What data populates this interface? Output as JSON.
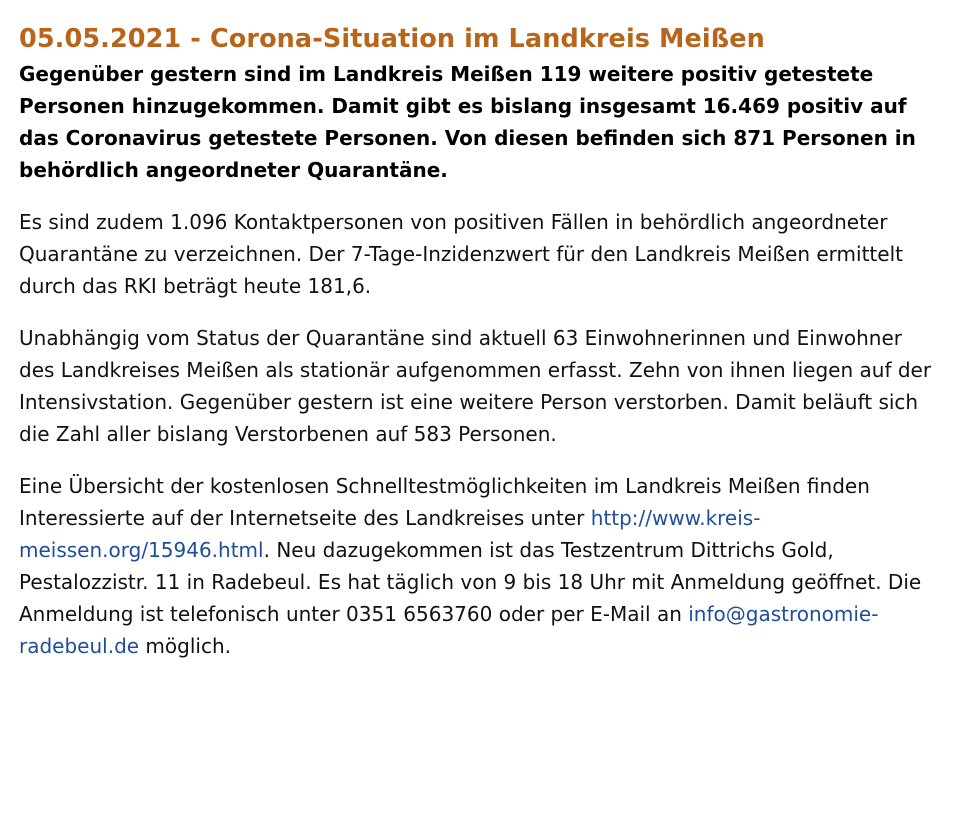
{
  "article": {
    "title": "05.05.2021 - Corona-Situation im Landkreis Meißen",
    "lead": "Gegenüber gestern sind im Landkreis Meißen 119 weitere positiv getestete Personen hinzugekommen. Damit gibt es bislang insgesamt 16.469 positiv auf das Coronavirus getestete Personen. Von diesen befinden sich 871 Personen in behördlich angeordneter Quarantäne.",
    "paragraph_1": "Es sind zudem 1.096 Kontaktpersonen von positiven Fällen in behördlich angeordneter Quarantäne zu verzeichnen. Der 7-Tage-Inzidenzwert für den Landkreis Meißen ermittelt durch das RKI beträgt heute 181,6.",
    "paragraph_2": "Unabhängig vom Status der Quarantäne sind aktuell 63 Einwohnerinnen und Einwohner des Landkreises Meißen als stationär aufgenommen erfasst. Zehn von ihnen liegen auf der Intensivstation. Gegenüber gestern ist eine weitere Person verstorben. Damit beläuft sich die Zahl aller bislang Verstorbenen auf 583 Personen.",
    "paragraph_3": {
      "text_before_link": "Eine Übersicht der kostenlosen Schnelltestmöglichkeiten im Landkreis Meißen finden Interessierte auf der Internetseite des Landkreises unter ",
      "link_text": "http://www.kreis-meissen.org/15946.html",
      "text_after_link": ". Neu dazugekommen ist das Testzentrum Dittrichs Gold, Pestalozzistr. 11 in Radebeul. Es hat täglich von 9 bis 18 Uhr mit Anmeldung geöffnet. Die Anmeldung ist telefonisch unter 0351 6563760 oder per E-Mail an ",
      "email_text": "info@gastronomie-radebeul.de",
      "text_end": " möglich."
    }
  },
  "colors": {
    "title": "#b8651b",
    "link": "#1f4e99",
    "text": "#111111"
  }
}
